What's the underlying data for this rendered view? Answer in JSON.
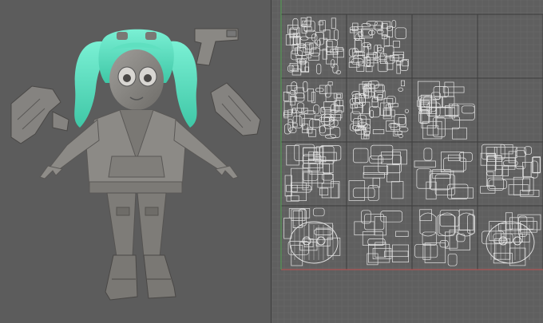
{
  "viewport": {
    "background": "#5c5c5c",
    "model": {
      "hair_color": "#5fe0c0",
      "body_color": "#8c8a86",
      "shade_color": "#6a6864",
      "icons": [
        "pistol-icon",
        "gauntlet-left-icon",
        "gauntlet-right-icon"
      ]
    }
  },
  "uv_editor": {
    "background": "#5f5f5f",
    "grid_color": "#6b6b6b",
    "tile_border_color": "#3e3e3e",
    "uv_line_color": "#e6e6e6",
    "axis_x_color": "#c05050",
    "axis_y_color": "#50a050",
    "tiles": [
      {
        "row": 0,
        "col": 0,
        "filled": true,
        "kind": "dense"
      },
      {
        "row": 0,
        "col": 1,
        "filled": true,
        "kind": "dense"
      },
      {
        "row": 0,
        "col": 2,
        "filled": false,
        "kind": "empty"
      },
      {
        "row": 0,
        "col": 3,
        "filled": false,
        "kind": "empty"
      },
      {
        "row": 1,
        "col": 0,
        "filled": true,
        "kind": "dense"
      },
      {
        "row": 1,
        "col": 1,
        "filled": true,
        "kind": "dense"
      },
      {
        "row": 1,
        "col": 2,
        "filled": true,
        "kind": "mixed"
      },
      {
        "row": 1,
        "col": 3,
        "filled": false,
        "kind": "empty"
      },
      {
        "row": 2,
        "col": 0,
        "filled": true,
        "kind": "mixed"
      },
      {
        "row": 2,
        "col": 1,
        "filled": true,
        "kind": "hardware"
      },
      {
        "row": 2,
        "col": 2,
        "filled": true,
        "kind": "panels"
      },
      {
        "row": 2,
        "col": 3,
        "filled": true,
        "kind": "mixed"
      },
      {
        "row": 3,
        "col": 0,
        "filled": true,
        "kind": "face"
      },
      {
        "row": 3,
        "col": 1,
        "filled": true,
        "kind": "panels"
      },
      {
        "row": 3,
        "col": 2,
        "filled": true,
        "kind": "hands"
      },
      {
        "row": 3,
        "col": 3,
        "filled": true,
        "kind": "hood"
      }
    ]
  }
}
